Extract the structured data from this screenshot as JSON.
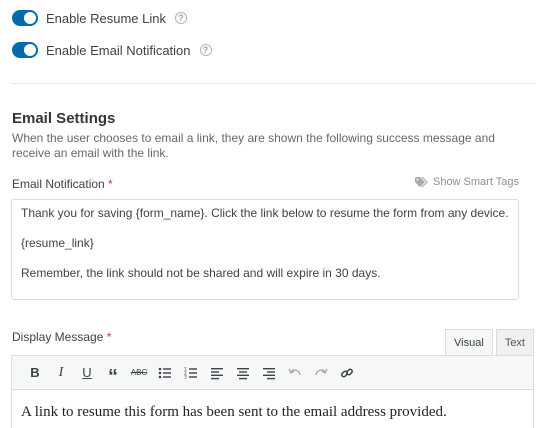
{
  "toggles": [
    {
      "label": "Enable Resume Link",
      "on": true
    },
    {
      "label": "Enable Email Notification",
      "on": true
    }
  ],
  "help_icon": "question-circle-icon",
  "email_settings": {
    "title": "Email Settings",
    "description": "When the user chooses to email a link, they are shown the following success message and receive an email with the link."
  },
  "email_notification": {
    "label": "Email Notification",
    "required_mark": "*",
    "smart_tags_label": "Show Smart Tags",
    "lines": [
      "Thank you for saving {form_name}. Click the link below to resume the form from any device.",
      "{resume_link}",
      "Remember, the link should not be shared and will expire in 30 days."
    ]
  },
  "display_message": {
    "label": "Display Message",
    "required_mark": "*",
    "tabs": [
      "Visual",
      "Text"
    ],
    "active_tab": "Visual",
    "toolbar": [
      "bold",
      "italic",
      "underline",
      "blockquote",
      "strikethrough",
      "bullet-list",
      "numbered-list",
      "align-left",
      "align-center",
      "align-right",
      "undo",
      "redo",
      "link"
    ],
    "content": "A link to resume this form has been sent to the email address provided."
  },
  "colors": {
    "accent": "#036aab",
    "required": "#d63638"
  }
}
